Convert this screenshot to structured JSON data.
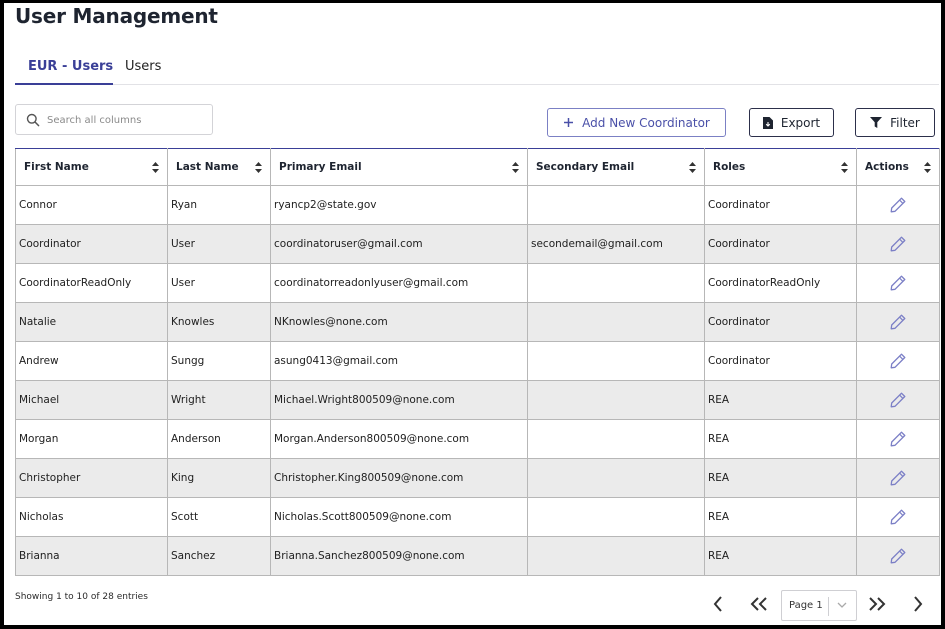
{
  "page": {
    "title": "User Management"
  },
  "tabs": [
    {
      "label": "EUR - Users",
      "active": true
    },
    {
      "label": "Users",
      "active": false
    }
  ],
  "search": {
    "placeholder": "Search all columns",
    "value": ""
  },
  "toolbar": {
    "add_label": "Add New Coordinator",
    "export_label": "Export",
    "filter_label": "Filter"
  },
  "table": {
    "columns": [
      "First Name",
      "Last Name",
      "Primary Email",
      "Secondary Email",
      "Roles",
      "Actions"
    ],
    "rows": [
      [
        "Connor",
        "Ryan",
        "ryancp2@state.gov",
        "",
        "Coordinator"
      ],
      [
        "Coordinator",
        "User",
        "coordinatoruser@gmail.com",
        "secondemail@gmail.com",
        "Coordinator"
      ],
      [
        "CoordinatorReadOnly",
        "User",
        "coordinatorreadonlyuser@gmail.com",
        "",
        "CoordinatorReadOnly"
      ],
      [
        "Natalie",
        "Knowles",
        "NKnowles@none.com",
        "",
        "Coordinator"
      ],
      [
        "Andrew",
        "Sungg",
        "asung0413@gmail.com",
        "",
        "Coordinator"
      ],
      [
        "Michael",
        "Wright",
        "Michael.Wright800509@none.com",
        "",
        "REA"
      ],
      [
        "Morgan",
        "Anderson",
        "Morgan.Anderson800509@none.com",
        "",
        "REA"
      ],
      [
        "Christopher",
        "King",
        "Christopher.King800509@none.com",
        "",
        "REA"
      ],
      [
        "Nicholas",
        "Scott",
        "Nicholas.Scott800509@none.com",
        "",
        "REA"
      ],
      [
        "Brianna",
        "Sanchez",
        "Brianna.Sanchez800509@none.com",
        "",
        "REA"
      ]
    ]
  },
  "footer": {
    "showing": "Showing 1 to 10 of 28 entries",
    "page_label": "Page 1"
  },
  "colors": {
    "accent": "#3a3f97",
    "row_alt": "#ebebeb",
    "edit_icon": "#7b7fc6"
  },
  "icons": {
    "search": "search-icon",
    "add": "plus-icon",
    "export": "file-export-icon",
    "filter": "funnel-icon",
    "edit": "pencil-icon",
    "sort": "sort-icon",
    "prev": "chevron-left-icon",
    "first": "double-chevron-left-icon",
    "last": "double-chevron-right-icon",
    "next": "chevron-right-icon"
  }
}
